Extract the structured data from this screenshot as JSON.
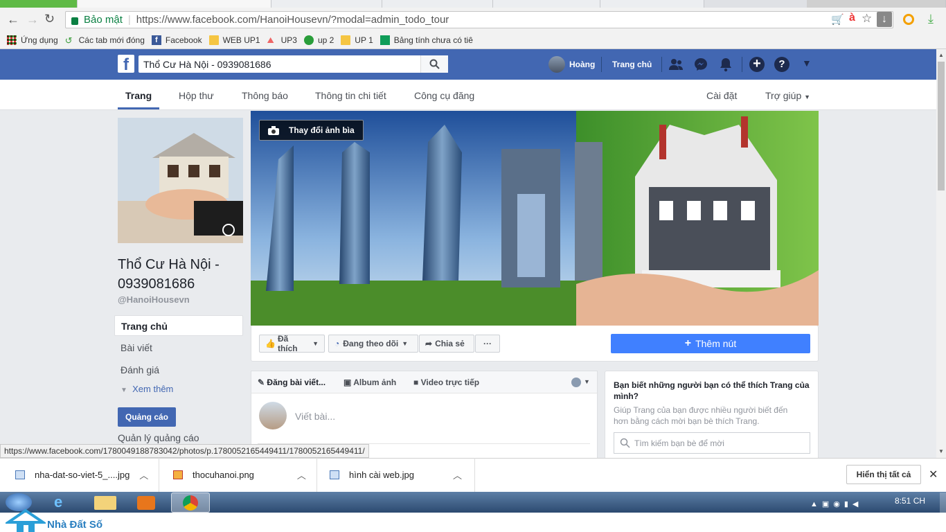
{
  "browser": {
    "security_label": "Bảo mật",
    "url": "https://www.facebook.com/HanoiHousevn/?modal=admin_todo_tour",
    "bookmarks": [
      "Ứng dụng",
      "Các tab mới đóng",
      "Facebook",
      "WEB UP1",
      "UP3",
      "up 2",
      "UP 1",
      "Bảng tính chưa có tiê"
    ]
  },
  "fb": {
    "search_value": "Thổ Cư Hà Nội - 0939081686",
    "user_name": "Hoàng",
    "home_label": "Trang chủ",
    "subnav": [
      "Trang",
      "Hộp thư",
      "Thông báo",
      "Thông tin chi tiết",
      "Công cụ đăng"
    ],
    "settings": "Cài đặt",
    "help": "Trợ giúp",
    "page_name": "Thổ Cư Hà Nội -\n0939081686",
    "page_name_l1": "Thổ Cư Hà Nội -",
    "page_name_l2": "0939081686",
    "handle": "@HanoiHousevn",
    "left_menu": [
      "Trang chủ",
      "Bài viết",
      "Đánh giá"
    ],
    "see_more": "Xem thêm",
    "ads_button": "Quảng cáo",
    "manage_ads": "Quản lý quảng cáo",
    "change_cover": "Thay đổi ảnh bìa",
    "liked": "Đã thích",
    "following": "Đang theo dõi",
    "share": "Chia sẻ",
    "more": "···",
    "add_button": "Thêm nút",
    "composer_post": "Đăng bài viết...",
    "composer_album": "Album ảnh",
    "composer_live": "Video trực tiếp",
    "composer_placeholder": "Viết bài...",
    "invite_title": "Bạn biết những người bạn có thể thích Trang của mình?",
    "invite_desc": "Giúp Trang của bạn được nhiều người biết đến hơn bằng cách mời bạn bè thích Trang.",
    "invite_search_placeholder": "Tìm kiếm bạn bè để mời"
  },
  "status_url": "https://www.facebook.com/1780049188783042/photos/p.1780052165449411/1780052165449411/",
  "downloads": {
    "items": [
      "nha-dat-so-viet-5_....jpg",
      "thocuhanoi.png",
      "hình cài web.jpg"
    ],
    "show_all": "Hiển thị tất cả"
  },
  "taskbar": {
    "time": "8:51 CH"
  },
  "watermark": "Nhà Đất Số",
  "colors": {
    "fb_blue": "#4267b2",
    "button_blue": "#4080ff"
  }
}
